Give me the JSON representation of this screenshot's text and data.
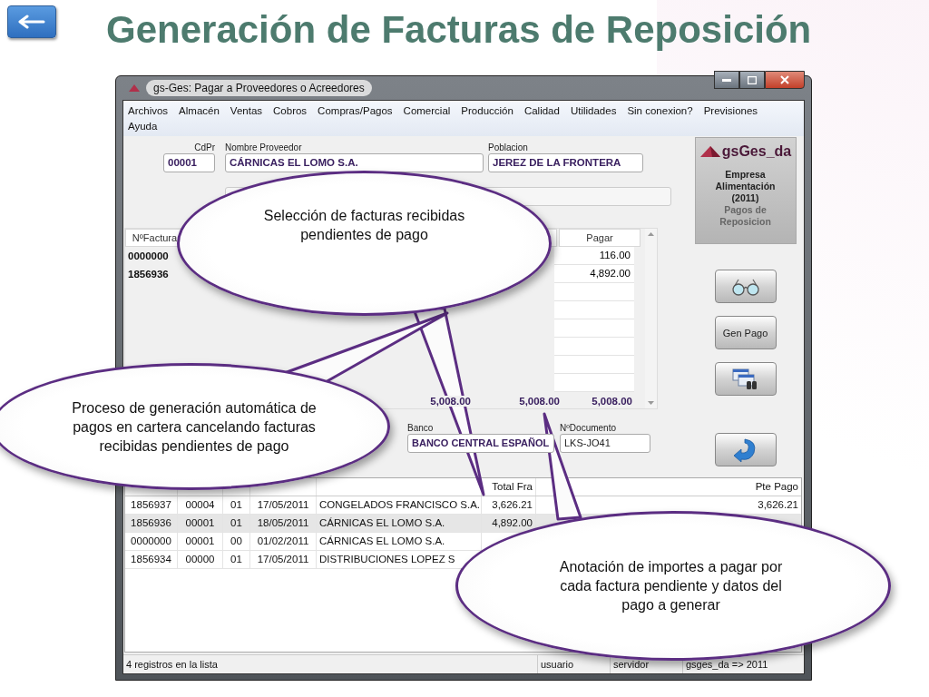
{
  "slide": {
    "title": "Generación de Facturas de Reposición"
  },
  "window": {
    "title": "gs-Ges: Pagar a Proveedores o Acreedores"
  },
  "menu": [
    "Archivos",
    "Almacén",
    "Ventas",
    "Cobros",
    "Compras/Pagos",
    "Comercial",
    "Producción",
    "Calidad",
    "Utilidades",
    "Sin conexion?",
    "Previsiones",
    "Ayuda"
  ],
  "form": {
    "cdpr_label": "CdPr",
    "cdpr": "00001",
    "nombre_label": "Nombre Proveedor",
    "nombre": "CÁRNICAS EL LOMO S.A.",
    "poblacion_label": "Poblacion",
    "poblacion": "JEREZ DE LA FRONTERA"
  },
  "pending_grid": {
    "headers": {
      "nfactura": "NºFactura",
      "pagar": "Pagar"
    },
    "rows": [
      {
        "nfactura": "0000000",
        "pagar": "116.00"
      },
      {
        "nfactura": "1856936",
        "pagar": "4,892.00"
      }
    ],
    "totals": {
      "importe": "5,008.00",
      "pendiente_pago": "5,008.00",
      "pagar": "5,008.00"
    }
  },
  "payment": {
    "banco_label": "Banco",
    "banco": "BANCO CENTRAL ESPAÑOL",
    "documento_label": "NºDocumento",
    "documento": "LKS-JO41"
  },
  "logo": {
    "name": "gsGes_da",
    "company_lines": [
      "Empresa",
      "Alimentación",
      "(2011)"
    ],
    "module_lines": [
      "Pagos de",
      "Reposicion"
    ]
  },
  "side_buttons": [
    {
      "kind": "glasses"
    },
    {
      "kind": "text",
      "label": "Gen Pago"
    },
    {
      "kind": "finder"
    },
    {
      "kind": "return"
    }
  ],
  "invoice_grid": {
    "headers": {
      "total_fra": "Total Fra",
      "pte_pago": "Pte Pago"
    },
    "rows": [
      {
        "num_fra": "1856937",
        "cdpr": "00004",
        "alm": "01",
        "fecha_fra": "17/05/2011",
        "nombre_proveedor": "CONGELADOS FRANCISCO S.A.",
        "total_fra": "3,626.21",
        "pte_pago": "3,626.21",
        "selected": false
      },
      {
        "num_fra": "1856936",
        "cdpr": "00001",
        "alm": "01",
        "fecha_fra": "18/05/2011",
        "nombre_proveedor": "CÁRNICAS EL LOMO S.A.",
        "total_fra": "4,892.00",
        "selected": true
      },
      {
        "num_fra": "0000000",
        "cdpr": "00001",
        "alm": "00",
        "fecha_fra": "01/02/2011",
        "nombre_proveedor": "CÁRNICAS EL LOMO S.A.",
        "selected": false
      },
      {
        "num_fra": "1856934",
        "cdpr": "00000",
        "alm": "01",
        "fecha_fra": "17/05/2011",
        "nombre_proveedor": "DISTRIBUCIONES LOPEZ S",
        "selected": false
      }
    ]
  },
  "status_bar": [
    "4 registros en la lista",
    "usuario",
    "servidor",
    "gsges_da => 2011"
  ],
  "callouts": [
    {
      "text": "Selección de facturas recibidas pendientes de pago"
    },
    {
      "text": "Proceso de generación automática de pagos en cartera cancelando facturas recibidas pendientes de pago"
    },
    {
      "text": "Anotación de importes a pagar por cada factura pendiente y datos del pago a generar"
    }
  ]
}
